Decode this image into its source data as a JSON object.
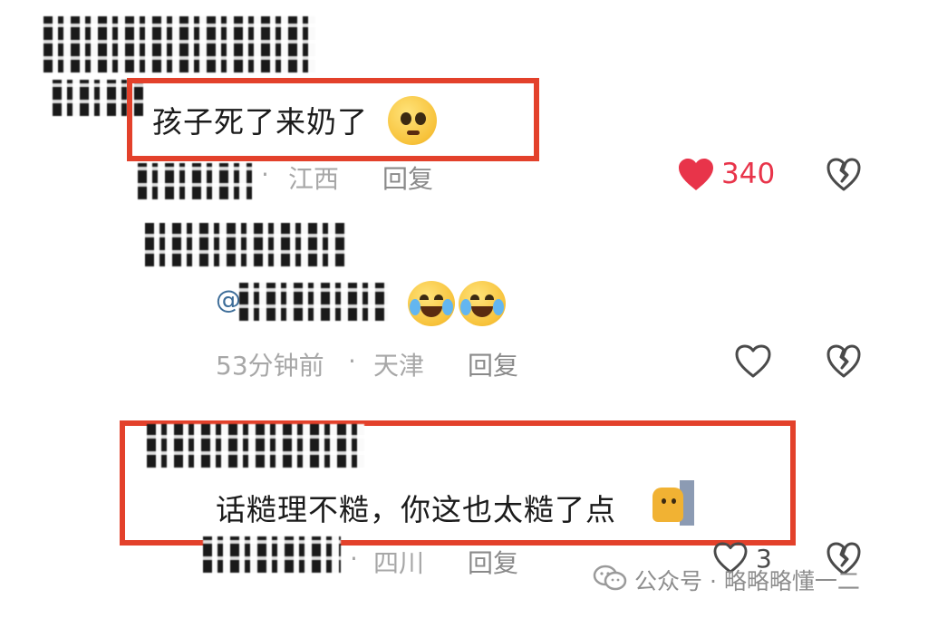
{
  "comment1": {
    "text": "孩子死了来奶了",
    "location": "江西",
    "reply_label": "回复",
    "like_count": "340",
    "liked": true,
    "emoji": "pleading-face-emoji"
  },
  "reply1": {
    "mention_prefix": "@",
    "time": "53分钟前",
    "separator": "·",
    "location": "天津",
    "reply_label": "回复",
    "emojis": [
      "tears-of-joy-emoji",
      "tears-of-joy-emoji"
    ]
  },
  "comment2": {
    "text": "话糙理不糙，你这也太糙了点",
    "location": "四川",
    "reply_label": "回复",
    "like_count": "3",
    "emoji": "cat-peeking-emoji"
  },
  "watermark": {
    "text": "公众号 · 略略略懂一二"
  },
  "colors": {
    "highlight_box": "#e3412b",
    "like_red": "#e8344a",
    "mention_blue": "#3c6c98",
    "meta_gray": "#a7a7a7"
  }
}
